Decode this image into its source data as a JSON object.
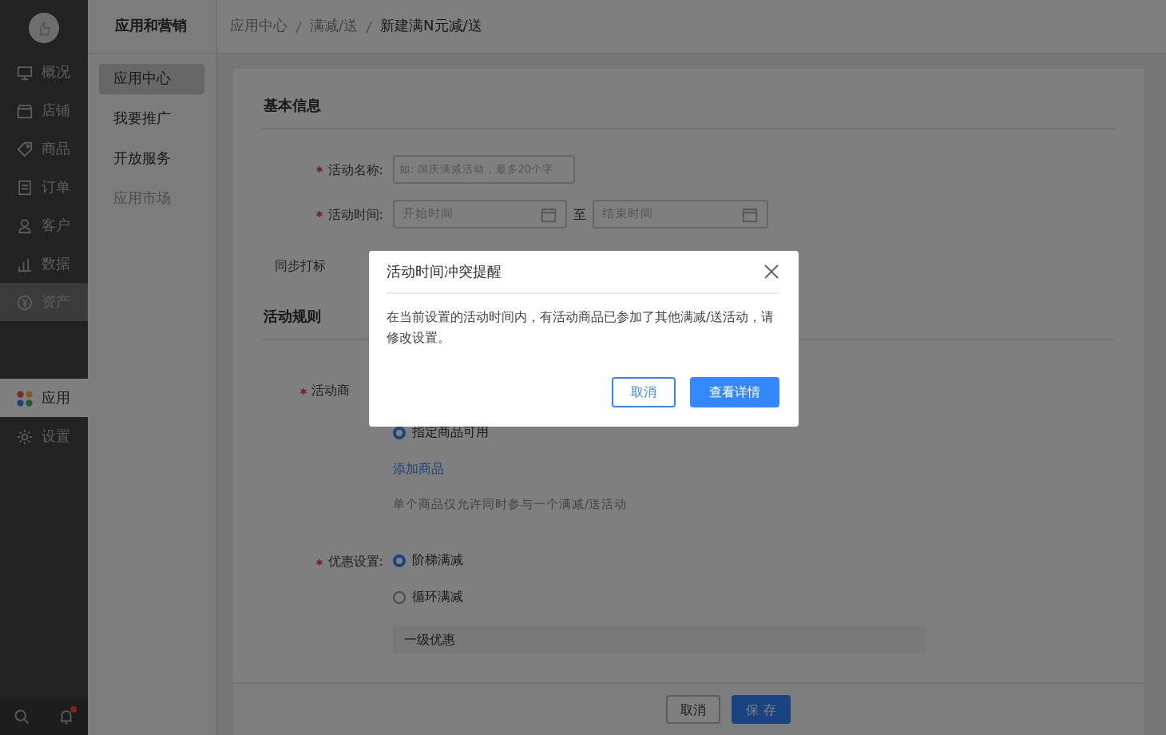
{
  "sidebar": {
    "items": [
      {
        "label": "概况",
        "selected": false,
        "highlighted": false
      },
      {
        "label": "店铺",
        "selected": false,
        "highlighted": false
      },
      {
        "label": "商品",
        "selected": false,
        "highlighted": false
      },
      {
        "label": "订单",
        "selected": false,
        "highlighted": false
      },
      {
        "label": "客户",
        "selected": false,
        "highlighted": false
      },
      {
        "label": "数据",
        "selected": false,
        "highlighted": false
      },
      {
        "label": "资产",
        "selected": false,
        "highlighted": true
      }
    ],
    "apps": [
      {
        "label": "应用",
        "selected": true
      },
      {
        "label": "设置",
        "selected": false
      }
    ],
    "notification_dot": true
  },
  "subnav": {
    "title": "应用和营销",
    "items": [
      {
        "label": "应用中心",
        "selected": true,
        "disabled": false
      },
      {
        "label": "我要推广",
        "selected": false,
        "disabled": false
      },
      {
        "label": "开放服务",
        "selected": false,
        "disabled": false
      },
      {
        "label": "应用市场",
        "selected": false,
        "disabled": true
      }
    ]
  },
  "breadcrumb": [
    "应用中心",
    "满减/送",
    "新建满N元减/送"
  ],
  "basic": {
    "title": "基本信息",
    "name": {
      "label": "活动名称:",
      "required": true,
      "placeholder": "如: 国庆满减活动，最多20个字"
    },
    "time": {
      "label": "活动时间:",
      "required": true,
      "start_placeholder": "开始时间",
      "separator": "至",
      "end_placeholder": "结束时间"
    },
    "tag_label": "同步打标"
  },
  "rules": {
    "title": "活动规则",
    "goods": {
      "label": "活动商",
      "required": true,
      "options": [
        {
          "label": "指定商品可用",
          "selected": true
        }
      ],
      "link": "添加商品",
      "hint": "单个商品仅允许同时参与一个满减/送活动"
    },
    "discount": {
      "label": "优惠设置:",
      "required": true,
      "options": [
        {
          "label": "阶梯满减",
          "selected": true
        },
        {
          "label": "循环满减",
          "selected": false
        }
      ],
      "tier": "一级优惠"
    }
  },
  "footer": {
    "cancel": "取消",
    "save": "保 存"
  },
  "dialog": {
    "title": "活动时间冲突提醒",
    "message": "在当前设置的活动时间内，有活动商品已参加了其他满减/送活动，请修改设置。",
    "cancel": "取消",
    "confirm": "查看详情"
  }
}
